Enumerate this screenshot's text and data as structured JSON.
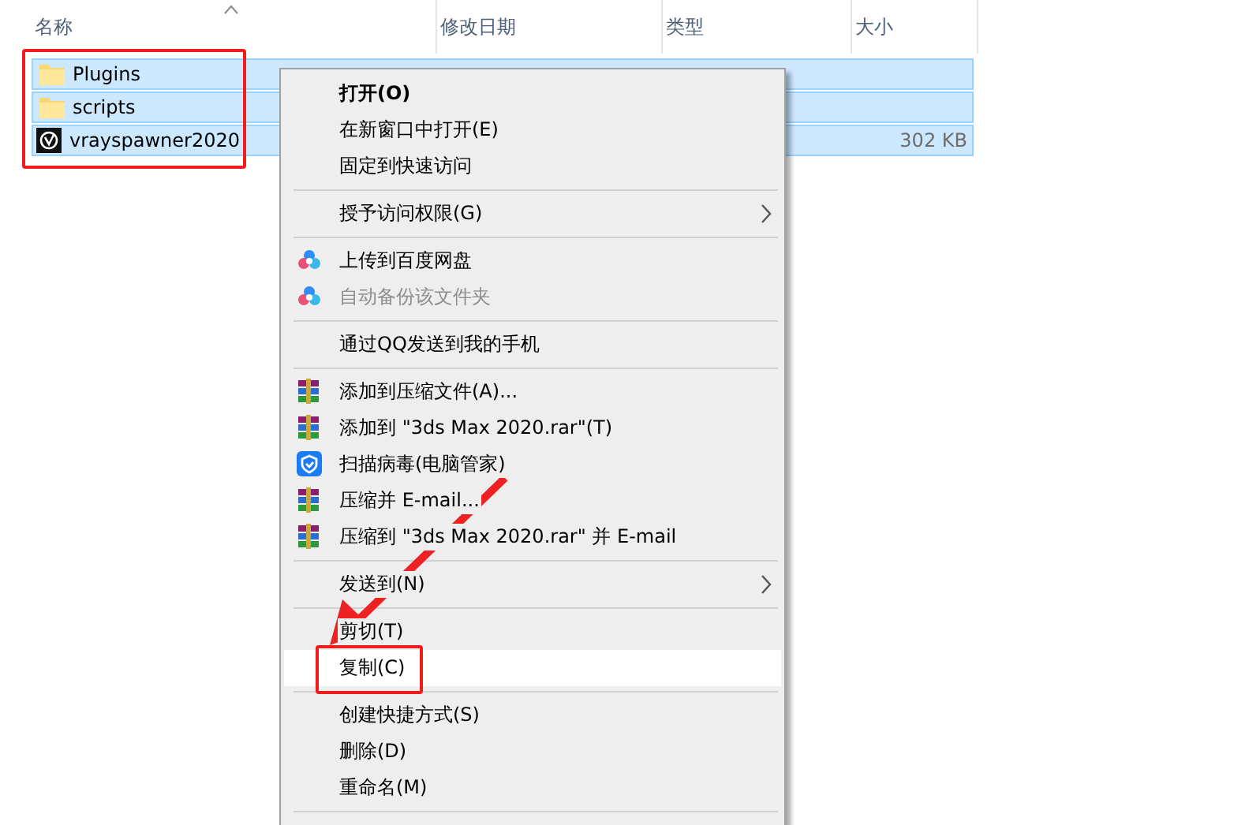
{
  "columns": [
    {
      "label": "名称",
      "sorted": true
    },
    {
      "label": "修改日期",
      "sorted": false
    },
    {
      "label": "类型",
      "sorted": false
    },
    {
      "label": "大小",
      "sorted": false
    }
  ],
  "files": [
    {
      "name": "Plugins",
      "kind": "folder",
      "selected": true
    },
    {
      "name": "scripts",
      "kind": "folder",
      "selected": true
    },
    {
      "name": "vrayspawner2020",
      "kind": "app",
      "size": "302 KB",
      "selected": true
    }
  ],
  "context_menu": [
    {
      "kind": "plain",
      "label": "打开(O)",
      "bold": true,
      "disabled": false,
      "selected": false,
      "submenu": false
    },
    {
      "kind": "plain",
      "label": "在新窗口中打开(E)",
      "bold": false,
      "disabled": false,
      "selected": false,
      "submenu": false
    },
    {
      "kind": "plain",
      "label": "固定到快速访问",
      "bold": false,
      "disabled": false,
      "selected": false,
      "submenu": false
    },
    {
      "kind": "separator"
    },
    {
      "kind": "plain",
      "label": "授予访问权限(G)",
      "bold": false,
      "disabled": false,
      "selected": false,
      "submenu": true
    },
    {
      "kind": "separator"
    },
    {
      "kind": "cloud",
      "label": "上传到百度网盘",
      "bold": false,
      "disabled": false,
      "selected": false,
      "submenu": false
    },
    {
      "kind": "cloud",
      "label": "自动备份该文件夹",
      "bold": false,
      "disabled": true,
      "selected": false,
      "submenu": false
    },
    {
      "kind": "separator"
    },
    {
      "kind": "plain",
      "label": "通过QQ发送到我的手机",
      "bold": false,
      "disabled": false,
      "selected": false,
      "submenu": false
    },
    {
      "kind": "separator"
    },
    {
      "kind": "archive",
      "label": "添加到压缩文件(A)...",
      "bold": false,
      "disabled": false,
      "selected": false,
      "submenu": false
    },
    {
      "kind": "archive",
      "label": "添加到 \"3ds Max 2020.rar\"(T)",
      "bold": false,
      "disabled": false,
      "selected": false,
      "submenu": false
    },
    {
      "kind": "shield",
      "label": "扫描病毒(电脑管家)",
      "bold": false,
      "disabled": false,
      "selected": false,
      "submenu": false
    },
    {
      "kind": "archive",
      "label": "压缩并 E-mail...",
      "bold": false,
      "disabled": false,
      "selected": false,
      "submenu": false
    },
    {
      "kind": "archive",
      "label": "压缩到 \"3ds Max 2020.rar\" 并 E-mail",
      "bold": false,
      "disabled": false,
      "selected": false,
      "submenu": false
    },
    {
      "kind": "separator"
    },
    {
      "kind": "plain",
      "label": "发送到(N)",
      "bold": false,
      "disabled": false,
      "selected": false,
      "submenu": true
    },
    {
      "kind": "separator"
    },
    {
      "kind": "plain",
      "label": "剪切(T)",
      "bold": false,
      "disabled": false,
      "selected": false,
      "submenu": false
    },
    {
      "kind": "plain",
      "label": "复制(C)",
      "bold": false,
      "disabled": false,
      "selected": true,
      "submenu": false
    },
    {
      "kind": "separator"
    },
    {
      "kind": "plain",
      "label": "创建快捷方式(S)",
      "bold": false,
      "disabled": false,
      "selected": false,
      "submenu": false
    },
    {
      "kind": "plain",
      "label": "删除(D)",
      "bold": false,
      "disabled": false,
      "selected": false,
      "submenu": false
    },
    {
      "kind": "plain",
      "label": "重命名(M)",
      "bold": false,
      "disabled": false,
      "selected": false,
      "submenu": false
    },
    {
      "kind": "separator"
    }
  ]
}
